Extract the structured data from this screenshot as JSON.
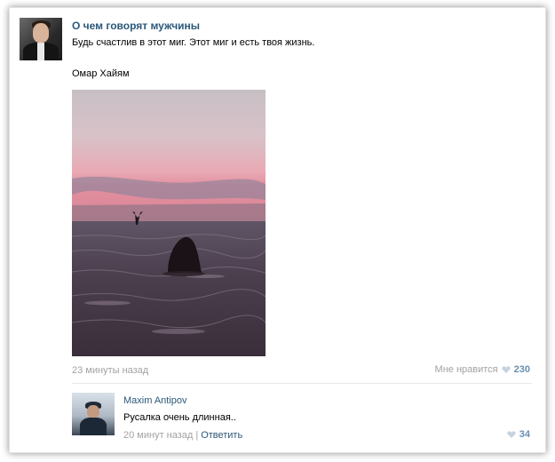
{
  "post": {
    "group_name": "О чем говорят мужчины",
    "text_line1": "Будь счастлив в этот миг. Этот миг и есть твоя жизнь.",
    "text_line2": "Омар Хайям",
    "time": "23 минуты назад",
    "likes_label": "Мне нравится",
    "likes_count": "230"
  },
  "comment": {
    "author": "Maxim Antipov",
    "text": "Русалка очень длинная..",
    "time": "20 минут назад",
    "separator": "|",
    "reply_label": "Ответить",
    "likes_count": "34"
  },
  "colors": {
    "link": "#2b587a",
    "muted": "#a2a2a2",
    "like_accent": "#6b8fb3"
  }
}
